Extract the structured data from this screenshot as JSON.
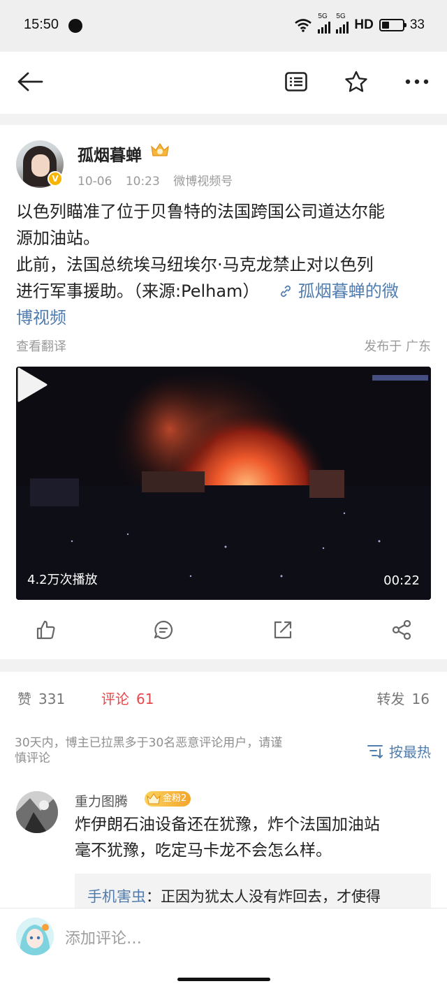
{
  "status_bar": {
    "time": "15:50",
    "network": "5G",
    "network2": "5G",
    "hd": "HD",
    "battery": "33"
  },
  "nav": {
    "back_icon": "arrow-left-icon",
    "article_icon": "article-view-icon",
    "favorite_icon": "star-icon",
    "more_icon": "more-icon"
  },
  "post": {
    "author": "孤烟暮蝉",
    "verified_badge": "V",
    "date": "10-06",
    "time": "10:23",
    "source": "微博视频号",
    "text_lines": [
      "以色列瞄准了位于贝鲁特的法国跨国公司道达尔能",
      "源加油站。",
      "此前，法国总统埃马纽埃尔·马克龙禁止对以色列",
      "进行军事援助。（来源:Pelham）"
    ],
    "video_link_line1": "孤烟暮蝉的微",
    "video_link_line2": "博视频",
    "translate": "查看翻译",
    "location": "发布于 广东",
    "video": {
      "views": "4.2万次播放",
      "duration": "00:22"
    }
  },
  "action_bar": {
    "like_icon": "thumbs-up-icon",
    "comment_icon": "comment-icon",
    "repost_icon": "repost-icon",
    "share_icon": "share-icon"
  },
  "stats": {
    "likes_label": "赞",
    "likes_count": "331",
    "comments_label": "评论",
    "comments_count": "61",
    "reposts_label": "转发",
    "reposts_count": "16"
  },
  "comments_section": {
    "notice_line1": "30天内，博主已拉黑多于30名恶意评论用户，请谨",
    "notice_line2": "慎评论",
    "sort_label": "按最热",
    "comments": [
      {
        "user": "重力图腾",
        "badge": "金粉2",
        "text_lines": [
          "炸伊朗石油设备还在犹豫，炸个法国加油站",
          "毫不犹豫，吃定马卡龙不会怎么样。"
        ],
        "reply_user": "手机害虫",
        "reply_text": "：正因为犹太人没有炸回去，才使得"
      }
    ]
  },
  "bottom": {
    "comment_placeholder": "添加评论…"
  },
  "colors": {
    "link": "#507daf",
    "active_tab": "#e8474b",
    "meta_gray": "#9a9a9a"
  }
}
